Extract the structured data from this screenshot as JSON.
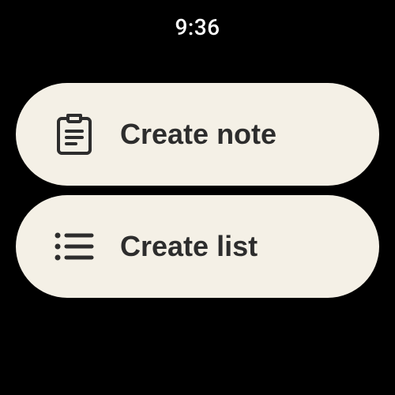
{
  "status_bar": {
    "time": "9:36"
  },
  "actions": [
    {
      "label": "Create note",
      "icon": "clipboard-note-icon"
    },
    {
      "label": "Create list",
      "icon": "list-icon"
    }
  ]
}
